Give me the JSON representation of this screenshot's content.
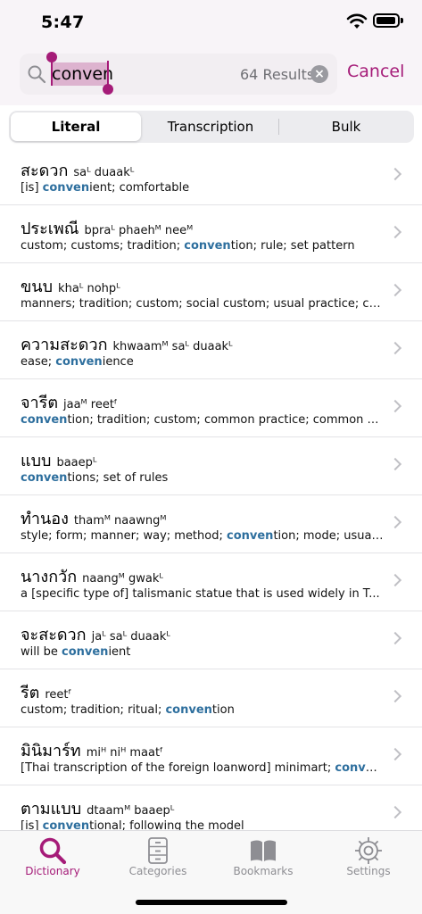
{
  "status": {
    "time": "5:47"
  },
  "search": {
    "value": "conven",
    "result_count": "64 Results",
    "cancel_label": "Cancel"
  },
  "segments": [
    "Literal",
    "Transcription",
    "Bulk"
  ],
  "results": [
    {
      "thai": "สะดวก",
      "trans": "saᴸ duaakᴸ",
      "def_pre": "[is] ",
      "def_hl": "conven",
      "def_post": "ient; comfortable"
    },
    {
      "thai": "ประเพณี",
      "trans": "bpraᴸ phaehᴹ neeᴹ",
      "def_pre": "custom; customs; tradition; ",
      "def_hl": "conven",
      "def_post": "tion; rule; set pattern"
    },
    {
      "thai": "ขนบ",
      "trans": "khaᴸ nohpᴸ",
      "def_pre": "manners; tradition; custom; social custom; usual practice; co...",
      "def_hl": "",
      "def_post": ""
    },
    {
      "thai": "ความสะดวก",
      "trans": "khwaamᴹ saᴸ duaakᴸ",
      "def_pre": "ease; ",
      "def_hl": "conven",
      "def_post": "ience"
    },
    {
      "thai": "จารีต",
      "trans": "jaaᴹ reetᶠ",
      "def_pre": "",
      "def_hl": "conven",
      "def_post": "tion; tradition; custom; common practice; common us..."
    },
    {
      "thai": "แบบ",
      "trans": "baaepᴸ",
      "def_pre": "",
      "def_hl": "conven",
      "def_post": "tions; set of rules"
    },
    {
      "thai": "ทำนอง",
      "trans": "thamᴹ naawngᴹ",
      "def_pre": "style; form; manner; way; method; ",
      "def_hl": "conven",
      "def_post": "tion; mode; usual..."
    },
    {
      "thai": "นางกวัก",
      "trans": "naangᴹ gwakᴸ",
      "def_pre": "a [specific type of] talismanic statue that is used widely in T...",
      "def_hl": "",
      "def_post": ""
    },
    {
      "thai": "จะสะดวก",
      "trans": "jaᴸ saᴸ duaakᴸ",
      "def_pre": "will be ",
      "def_hl": "conven",
      "def_post": "ient"
    },
    {
      "thai": "รีต",
      "trans": "reetᶠ",
      "def_pre": "custom; tradition; ritual; ",
      "def_hl": "conven",
      "def_post": "tion"
    },
    {
      "thai": "มินิมาร์ท",
      "trans": "miᴴ niᴴ maatᶠ",
      "def_pre": "[Thai transcription of the foreign loanword] minimart; ",
      "def_hl": "conve...",
      "def_post": ""
    },
    {
      "thai": "ตามแบบ",
      "trans": "dtaamᴹ baaepᴸ",
      "def_pre": "[is] ",
      "def_hl": "conven",
      "def_post": "tional; following the model"
    }
  ],
  "tabs": [
    {
      "label": "Dictionary",
      "icon": "magnifier-icon",
      "active": true
    },
    {
      "label": "Categories",
      "icon": "cabinet-icon",
      "active": false
    },
    {
      "label": "Bookmarks",
      "icon": "book-icon",
      "active": false
    },
    {
      "label": "Settings",
      "icon": "gear-icon",
      "active": false
    }
  ],
  "colors": {
    "accent": "#a51b78",
    "highlight": "#2e6f9e"
  }
}
